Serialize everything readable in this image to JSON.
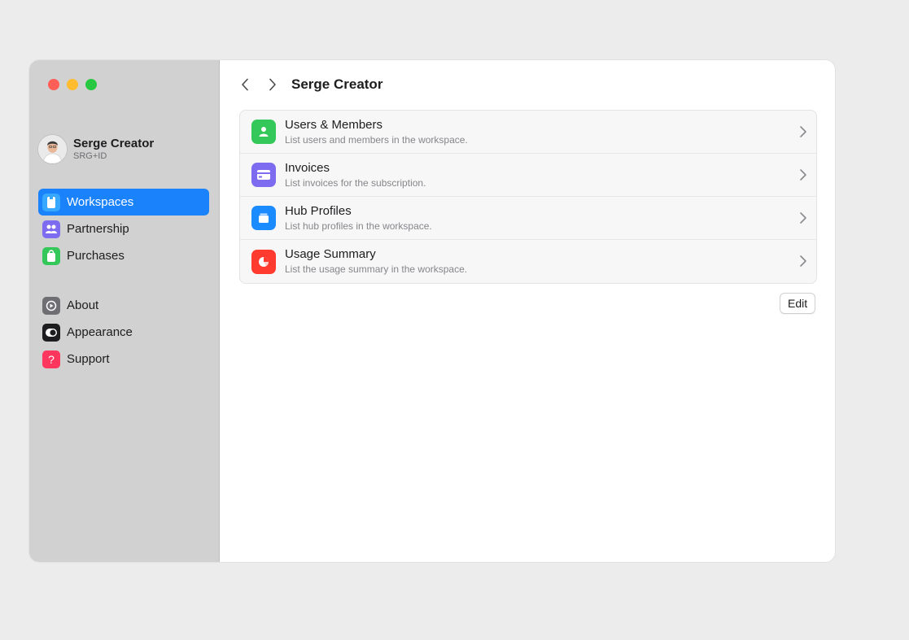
{
  "window": {
    "traffic_lights": {
      "close": "#ff5f57",
      "minimize": "#febc2e",
      "zoom": "#28c840"
    }
  },
  "profile": {
    "name": "Serge Creator",
    "id": "SRG+ID",
    "avatar_icon": "user-avatar"
  },
  "sidebar": {
    "group1": [
      {
        "label": "Workspaces",
        "icon": "workspace-icon",
        "color": "#30a2f7",
        "active": true
      },
      {
        "label": "Partnership",
        "icon": "people-icon",
        "color": "#7d6cf0",
        "active": false
      },
      {
        "label": "Purchases",
        "icon": "bag-icon",
        "color": "#34c759",
        "active": false
      }
    ],
    "group2": [
      {
        "label": "About",
        "icon": "info-icon",
        "color": "#6e6e73",
        "active": false
      },
      {
        "label": "Appearance",
        "icon": "appearance-icon",
        "color": "#1d1d1f",
        "active": false
      },
      {
        "label": "Support",
        "icon": "question-icon",
        "color": "#ff375f",
        "active": false
      }
    ],
    "active_color": "#1a82fb"
  },
  "toolbar": {
    "title": "Serge Creator",
    "back_icon": "chevron-left-icon",
    "forward_icon": "chevron-right-icon"
  },
  "list": [
    {
      "title": "Users & Members",
      "subtitle": "List users and members in the workspace.",
      "icon": "person-icon",
      "color": "#34c759"
    },
    {
      "title": "Invoices",
      "subtitle": "List invoices for the subscription.",
      "icon": "credit-card-icon",
      "color": "#7d6cf0"
    },
    {
      "title": "Hub Profiles",
      "subtitle": "List hub profiles in the workspace.",
      "icon": "folder-icon",
      "color": "#1a8cff"
    },
    {
      "title": "Usage Summary",
      "subtitle": "List the usage summary in the workspace.",
      "icon": "pie-chart-icon",
      "color": "#ff3b30"
    }
  ],
  "edit_label": "Edit"
}
